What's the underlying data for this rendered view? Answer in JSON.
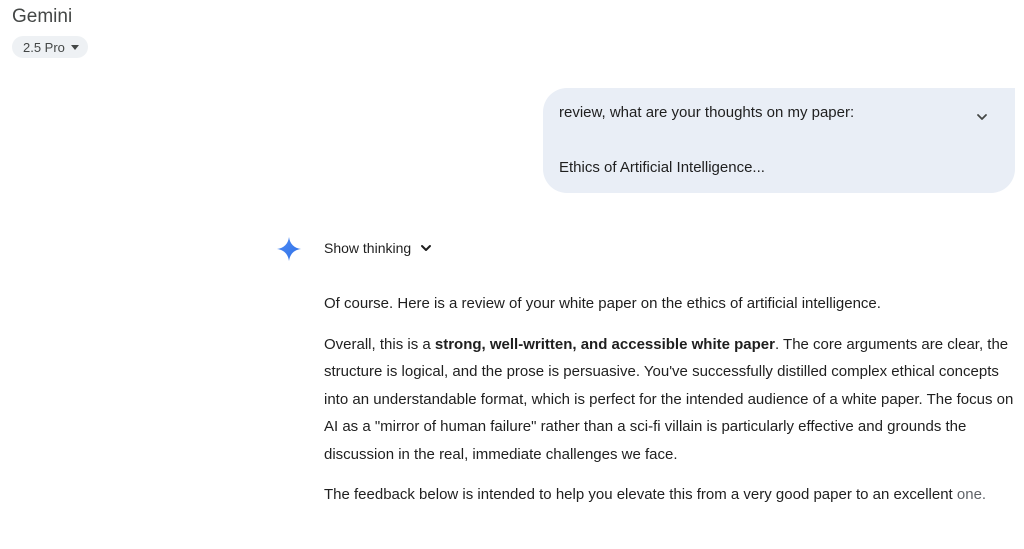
{
  "header": {
    "app_title": "Gemini",
    "model_selector": "2.5 Pro"
  },
  "user_message": {
    "line1": "review, what are your thoughts on my paper:",
    "line2": "Ethics of Artificial Intelligence..."
  },
  "response": {
    "show_thinking_label": "Show thinking",
    "p1": "Of course. Here is a review of your white paper on the ethics of artificial intelligence.",
    "p2_prefix": "Overall, this is a ",
    "p2_bold": "strong, well-written, and accessible white paper",
    "p2_suffix": ". The core arguments are clear, the structure is logical, and the prose is persuasive. You've successfully distilled complex ethical concepts into an understandable format, which is perfect for the intended audience of a white paper. The focus on AI as a \"mirror of human failure\" rather than a sci-fi villain is particularly effective and grounds the discussion in the real, immediate challenges we face.",
    "p3_main": "The feedback below is intended to help you elevate this from a very good paper to an excellent",
    "p3_end": "one."
  },
  "colors": {
    "user_bubble": "#e9eef6",
    "chip": "#eef1f4",
    "sparkle": "#4285f4"
  },
  "icons": {
    "model_caret": "caret-down-icon",
    "expand": "chevron-down-icon",
    "gemini": "gemini-sparkle-icon",
    "thinking": "chevron-down-icon"
  }
}
